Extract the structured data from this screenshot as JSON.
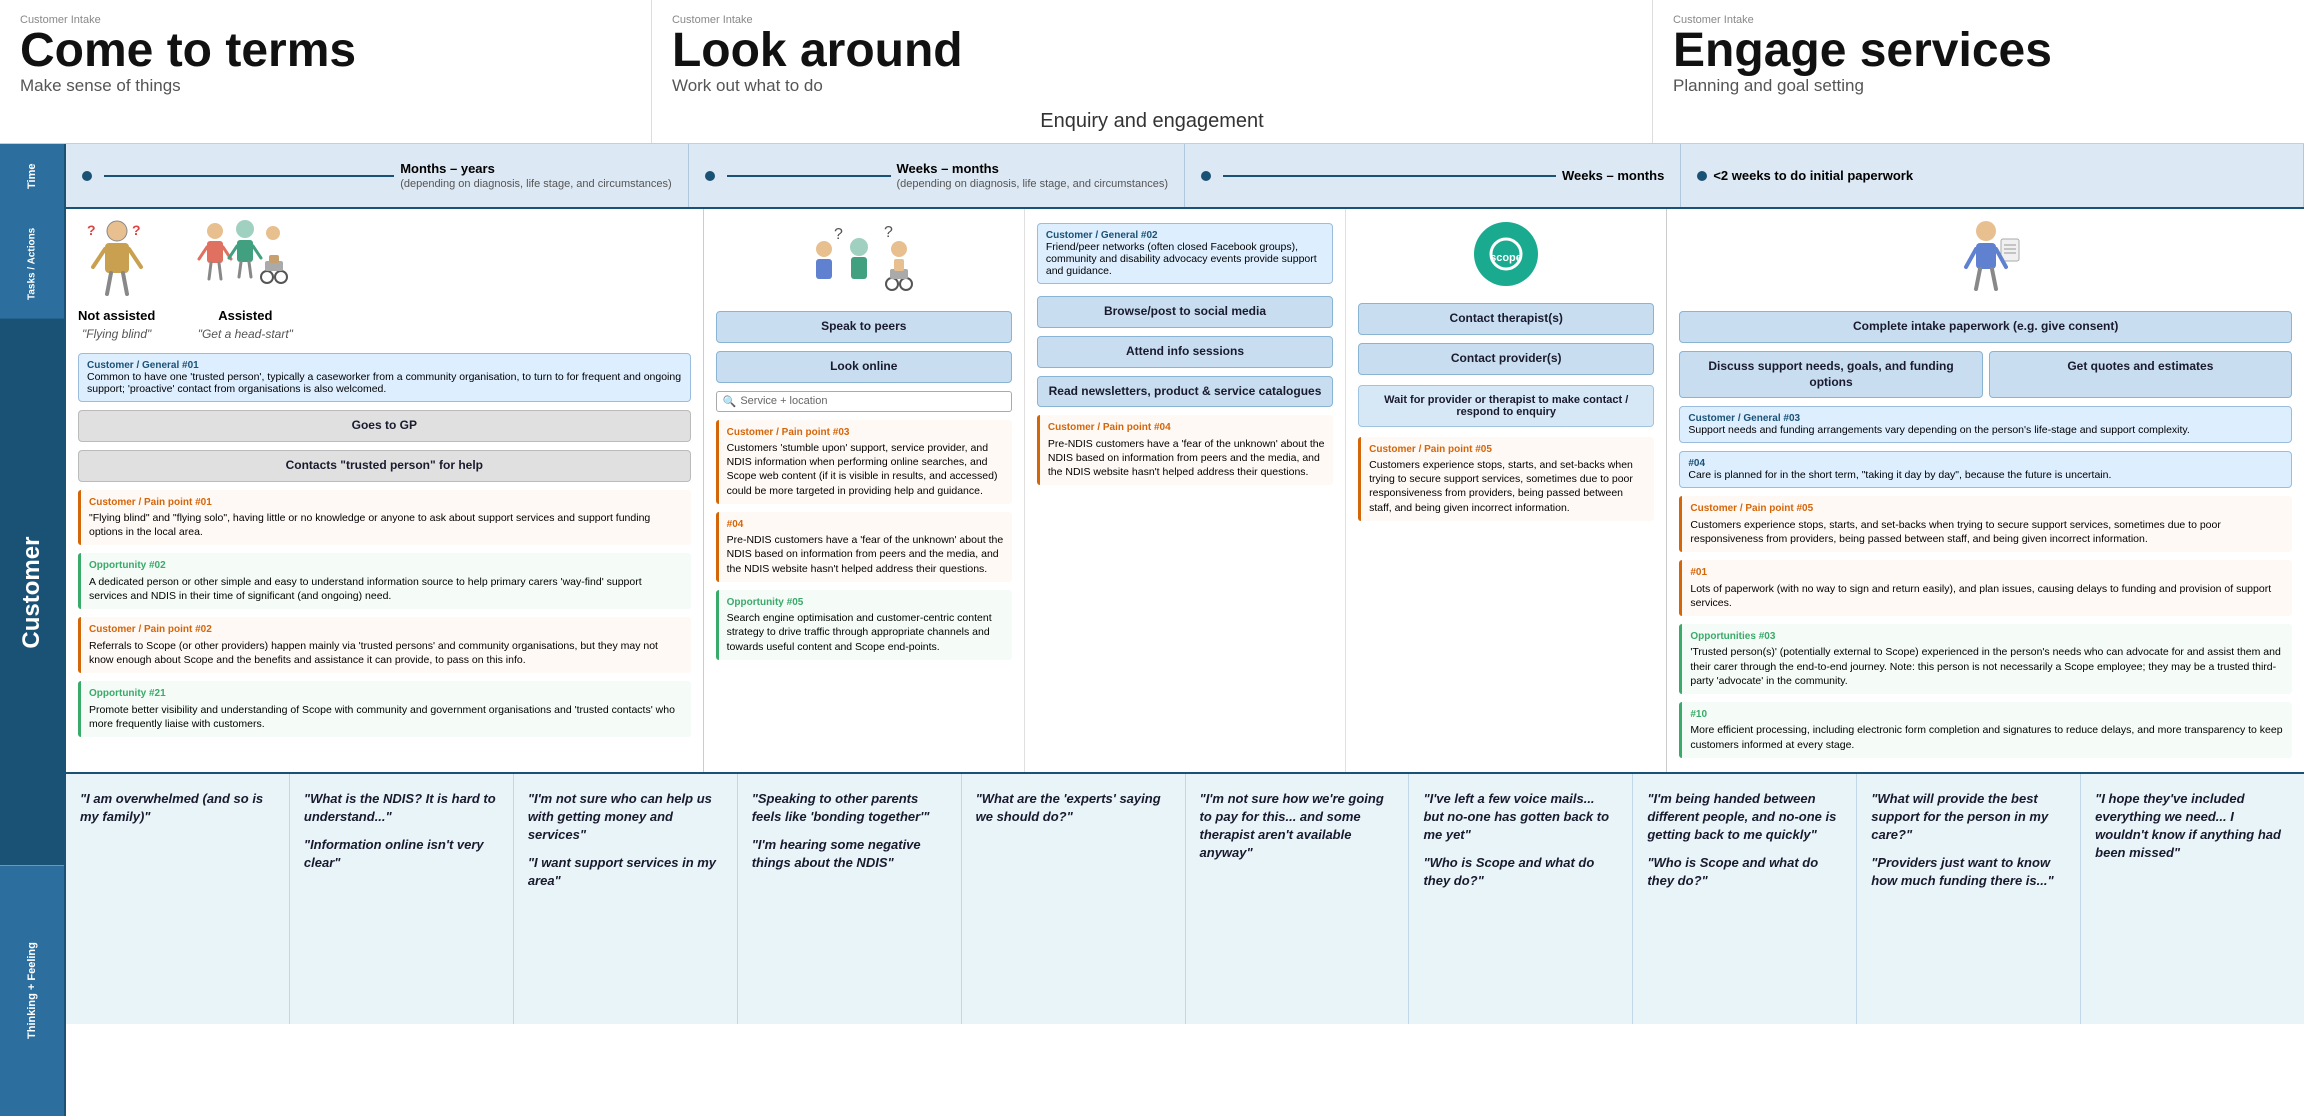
{
  "phases": [
    {
      "id": "p1",
      "intake_label": "Customer Intake",
      "title": "Come to terms",
      "subtitle": "Make sense of things"
    },
    {
      "id": "p2",
      "intake_label": "Customer Intake",
      "title": "Look around",
      "subtitle": "Work out what to do",
      "enquiry": "Enquiry and engagement"
    },
    {
      "id": "p3",
      "intake_label": "Customer Intake",
      "title": "Engage services",
      "subtitle": "Planning and goal setting"
    }
  ],
  "time": [
    {
      "main": "Months – years",
      "sub": "(depending on diagnosis, life stage, and circumstances)"
    },
    {
      "main": "Weeks – months",
      "sub": "(depending on diagnosis, life stage, and circumstances)"
    },
    {
      "main": "Weeks – months",
      "sub": ""
    },
    {
      "main": "<2 weeks to do initial paperwork",
      "sub": ""
    }
  ],
  "row_labels": {
    "time": "Time",
    "tasks": "Tasks / Actions",
    "customer": "Customer",
    "thinking": "Thinking + Feeling"
  },
  "col1": {
    "person1_label": "Not assisted",
    "person1_sub": "\"Flying blind\"",
    "person2_label": "Assisted",
    "person2_sub": "\"Get a head-start\"",
    "cust_general": "Customer / General #01",
    "cust_general_text": "Common to have one 'trusted person', typically a caseworker from a community organisation, to turn to for frequent and ongoing support; 'proactive' contact from organisations is also welcomed.",
    "actions": [
      "Goes to GP"
    ],
    "contacts": "Contacts \"trusted person\" for help",
    "pain1_label": "Customer / Pain point #01",
    "pain1_text": "\"Flying blind\" and \"flying solo\", having little or no knowledge or anyone to ask about support services and support funding options in the local area.",
    "opp1_label": "Opportunity #02",
    "opp1_text": "A dedicated person or other simple and easy to understand information source to help primary carers 'way-find' support services and NDIS in their time of significant (and ongoing) need.",
    "pain2_label": "Customer / Pain point #02",
    "pain2_text": "Referrals to Scope (or other providers) happen mainly via 'trusted persons' and community organisations, but they may not know enough about Scope and the benefits and assistance it can provide, to pass on this info.",
    "opp2_label": "Opportunity #21",
    "opp2_text": "Promote better visibility and understanding of Scope with community and government organisations and 'trusted contacts' who more frequently liaise with customers."
  },
  "col2": {
    "actions": [
      "Look online",
      "Browse/post to social media",
      "Attend info sessions",
      "Read newsletters, product & service catalogues"
    ],
    "search_placeholder": "Service + location",
    "cust_general2_hdr": "Customer / General #02",
    "cust_general2_text": "Friend/peer networks (often closed Facebook groups), community and disability advocacy events provide support and guidance.",
    "speaks_to_peers": "Speak to peers",
    "pain3_label": "Customer / Pain point #03",
    "pain3_text": "Customers 'stumble upon' support, service provider, and NDIS information when performing online searches, and Scope web content (if it is visible in results, and accessed) could be more targeted in providing help and guidance.",
    "pain4_label": "#04",
    "pain4_text": "Pre-NDIS customers have a 'fear of the unknown' about the NDIS based on information from peers and the media, and the NDIS website hasn't helped address their questions.",
    "opp3_label": "Opportunity #05",
    "opp3_text": "Search engine optimisation and customer-centric content strategy to drive traffic through appropriate channels and towards useful content and Scope end-points.",
    "pain5_label": "Customer / Pain point #04",
    "pain5_text": "Pre-NDIS customers have a 'fear of the unknown' about the NDIS based on information from peers and the media, and the NDIS website hasn't helped address their questions.",
    "contact_therapists": "Contact therapist(s)",
    "contact_providers": "Contact provider(s)",
    "wait_text": "Wait for provider or therapist to make contact / respond to enquiry",
    "pain6_label": "Customer / Pain point #05",
    "pain6_text": "Customers experience stops, starts, and set-backs when trying to secure support services, sometimes due to poor responsiveness from providers, being passed between staff, and being given incorrect information."
  },
  "col3": {
    "actions": [
      "Complete intake paperwork (e.g. give consent)",
      "Discuss support needs, goals, and funding options",
      "Get quotes and estimates"
    ],
    "cust_general3_hdr": "Customer / General #03",
    "cust_general3_text": "Support needs and funding arrangements vary depending on the person's life-stage and support complexity.",
    "cust_general3_hdr2": "#04",
    "cust_general3_text2": "Care is planned for in the short term, \"taking it day by day\", because the future is uncertain.",
    "pain7_label": "Customer / Pain point #05",
    "pain7_text": "Customers experience stops, starts, and set-backs when trying to secure support services, sometimes due to poor responsiveness from providers, being passed between staff, and being given incorrect information.",
    "pain7b_label": "#01",
    "pain7b_text": "Lots of paperwork (with no way to sign and return easily), and plan issues, causing delays to funding and provision of support services.",
    "opp4_label": "Opportunities #03",
    "opp4_text": "'Trusted person(s)' (potentially external to Scope) experienced in the person's needs who can advocate for and assist them and their carer through the end-to-end journey. Note: this person is not necessarily a Scope employee; they may be a trusted third-party 'advocate' in the community.",
    "opp5_label": "#10",
    "opp5_text": "More efficient processing, including electronic form completion and signatures to reduce delays, and more transparency to keep customers informed at every stage."
  },
  "thinking": [
    {
      "quote": "\"I am overwhelmed (and so is my family)\""
    },
    {
      "quote": "\"What is the NDIS? It is hard to understand...\"\n\n\"Information online isn't very clear\""
    },
    {
      "quote": "\"I'm not sure who can help us with getting money and services\"\n\n\"I want support services in my area\""
    },
    {
      "quote": "\"Speaking to other parents feels like 'bonding together'\"\n\n\"I'm hearing some negative things about the NDIS\""
    },
    {
      "quote": "\"What are the 'experts' saying we should do?\""
    },
    {
      "quote": "\"I'm not sure how we're going to pay for this... and some therapist aren't available anyway\""
    },
    {
      "quote": "\"I've left a few voice mails... but no-one has gotten back to me yet\"\n\n\"Who is Scope and what do they do?\""
    },
    {
      "quote": "\"I'm being handed between different people, and no-one is getting back to me quickly\"\n\n\"Who is Scope and what do they do?\""
    },
    {
      "quote": "\"What will provide the best support for the person in my care?\"\n\n\"Providers just want to know how much funding there is...\""
    },
    {
      "quote": "\"I hope they've included everything we need... I wouldn't know if anything had been missed\""
    }
  ]
}
